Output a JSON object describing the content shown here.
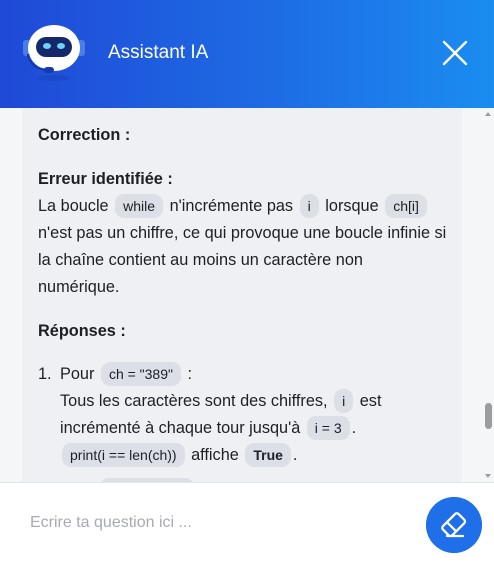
{
  "header": {
    "title": "Assistant IA",
    "avatar_icon": "robot-icon",
    "close_icon": "close-icon"
  },
  "message": {
    "correction_heading": "Correction :",
    "error_heading": "Erreur identifiée :",
    "error_text_1": "La boucle",
    "code_while": "while",
    "error_text_2": "n'incrémente pas",
    "code_i": "i",
    "error_text_3": "lorsque",
    "code_chi": "ch[i]",
    "error_text_4": "n'est pas un chiffre, ce qui provoque une boucle infinie si la chaîne contient au moins un caractère non numérique.",
    "answers_heading": "Réponses :",
    "item1": {
      "number": "1.",
      "text_1": "Pour",
      "code_ch": "ch = \"389\"",
      "text_2": ":",
      "text_3": "Tous les caractères sont des chiffres,",
      "code_i": "i",
      "text_4": "est incrémenté à chaque tour jusqu'à",
      "code_i3": "i = 3",
      "text_5": ".",
      "code_print": "print(i == len(ch))",
      "text_6": "affiche",
      "code_true": "True",
      "text_7": "."
    }
  },
  "input": {
    "placeholder": "Ecrire ta question ici ...",
    "value": ""
  },
  "send_button": {
    "icon": "eraser-icon"
  },
  "colors": {
    "header_start": "#1f49d6",
    "header_end": "#1a8df0",
    "accent": "#1f6fe8",
    "bubble": "#eef0f3",
    "code_bg": "#dcdfe5"
  }
}
